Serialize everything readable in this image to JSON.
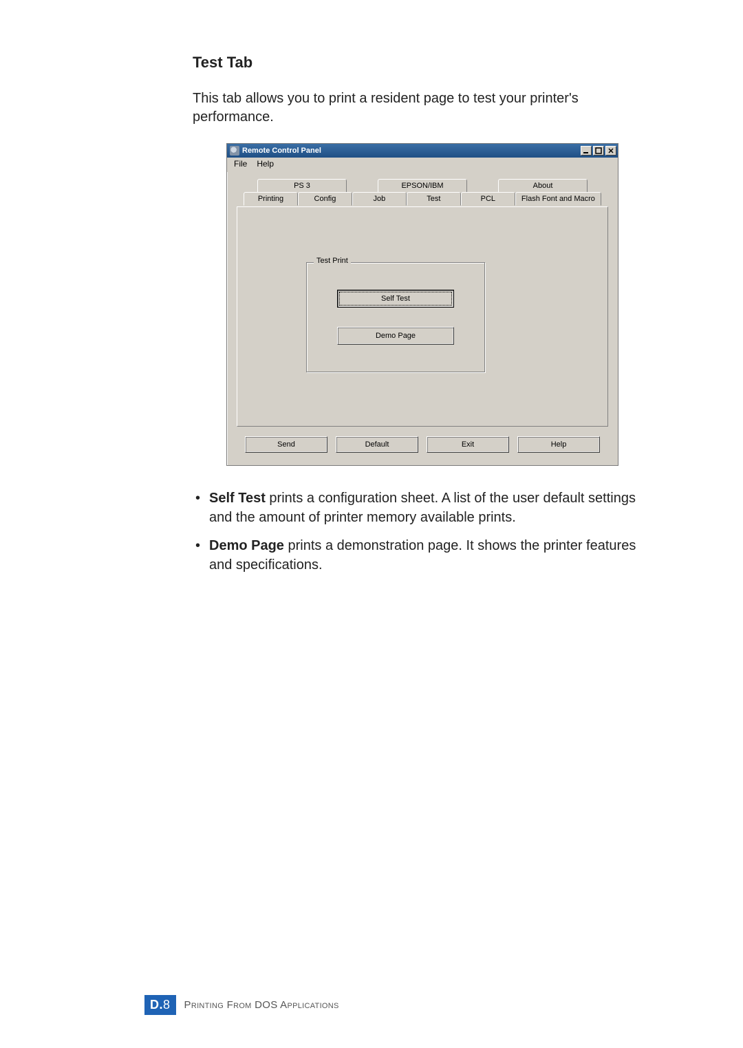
{
  "heading": "Test Tab",
  "intro": "This tab allows you to print a resident page to test your printer's performance.",
  "dialog": {
    "title": "Remote Control Panel",
    "menu": {
      "file": "File",
      "help": "Help"
    },
    "tabs_back": [
      "PS 3",
      "EPSON/IBM",
      "About"
    ],
    "tabs_front": [
      "Printing",
      "Config",
      "Job",
      "Test",
      "PCL",
      "Flash Font and Macro"
    ],
    "active_tab": "Test",
    "group_label": "Test Print",
    "self_test": "Self Test",
    "demo_page": "Demo Page",
    "buttons": {
      "send": "Send",
      "default": "Default",
      "exit": "Exit",
      "help": "Help"
    }
  },
  "bullets": {
    "b1_bold": "Self Test",
    "b1_rest": " prints a configuration sheet. A list of the user default settings and the amount of printer memory available prints.",
    "b2_bold": "Demo Page",
    "b2_rest": " prints a demonstration page. It shows the printer features and specifications."
  },
  "footer": {
    "badge_letter": "D.",
    "badge_num": "8",
    "text": "Printing From DOS Applications"
  }
}
